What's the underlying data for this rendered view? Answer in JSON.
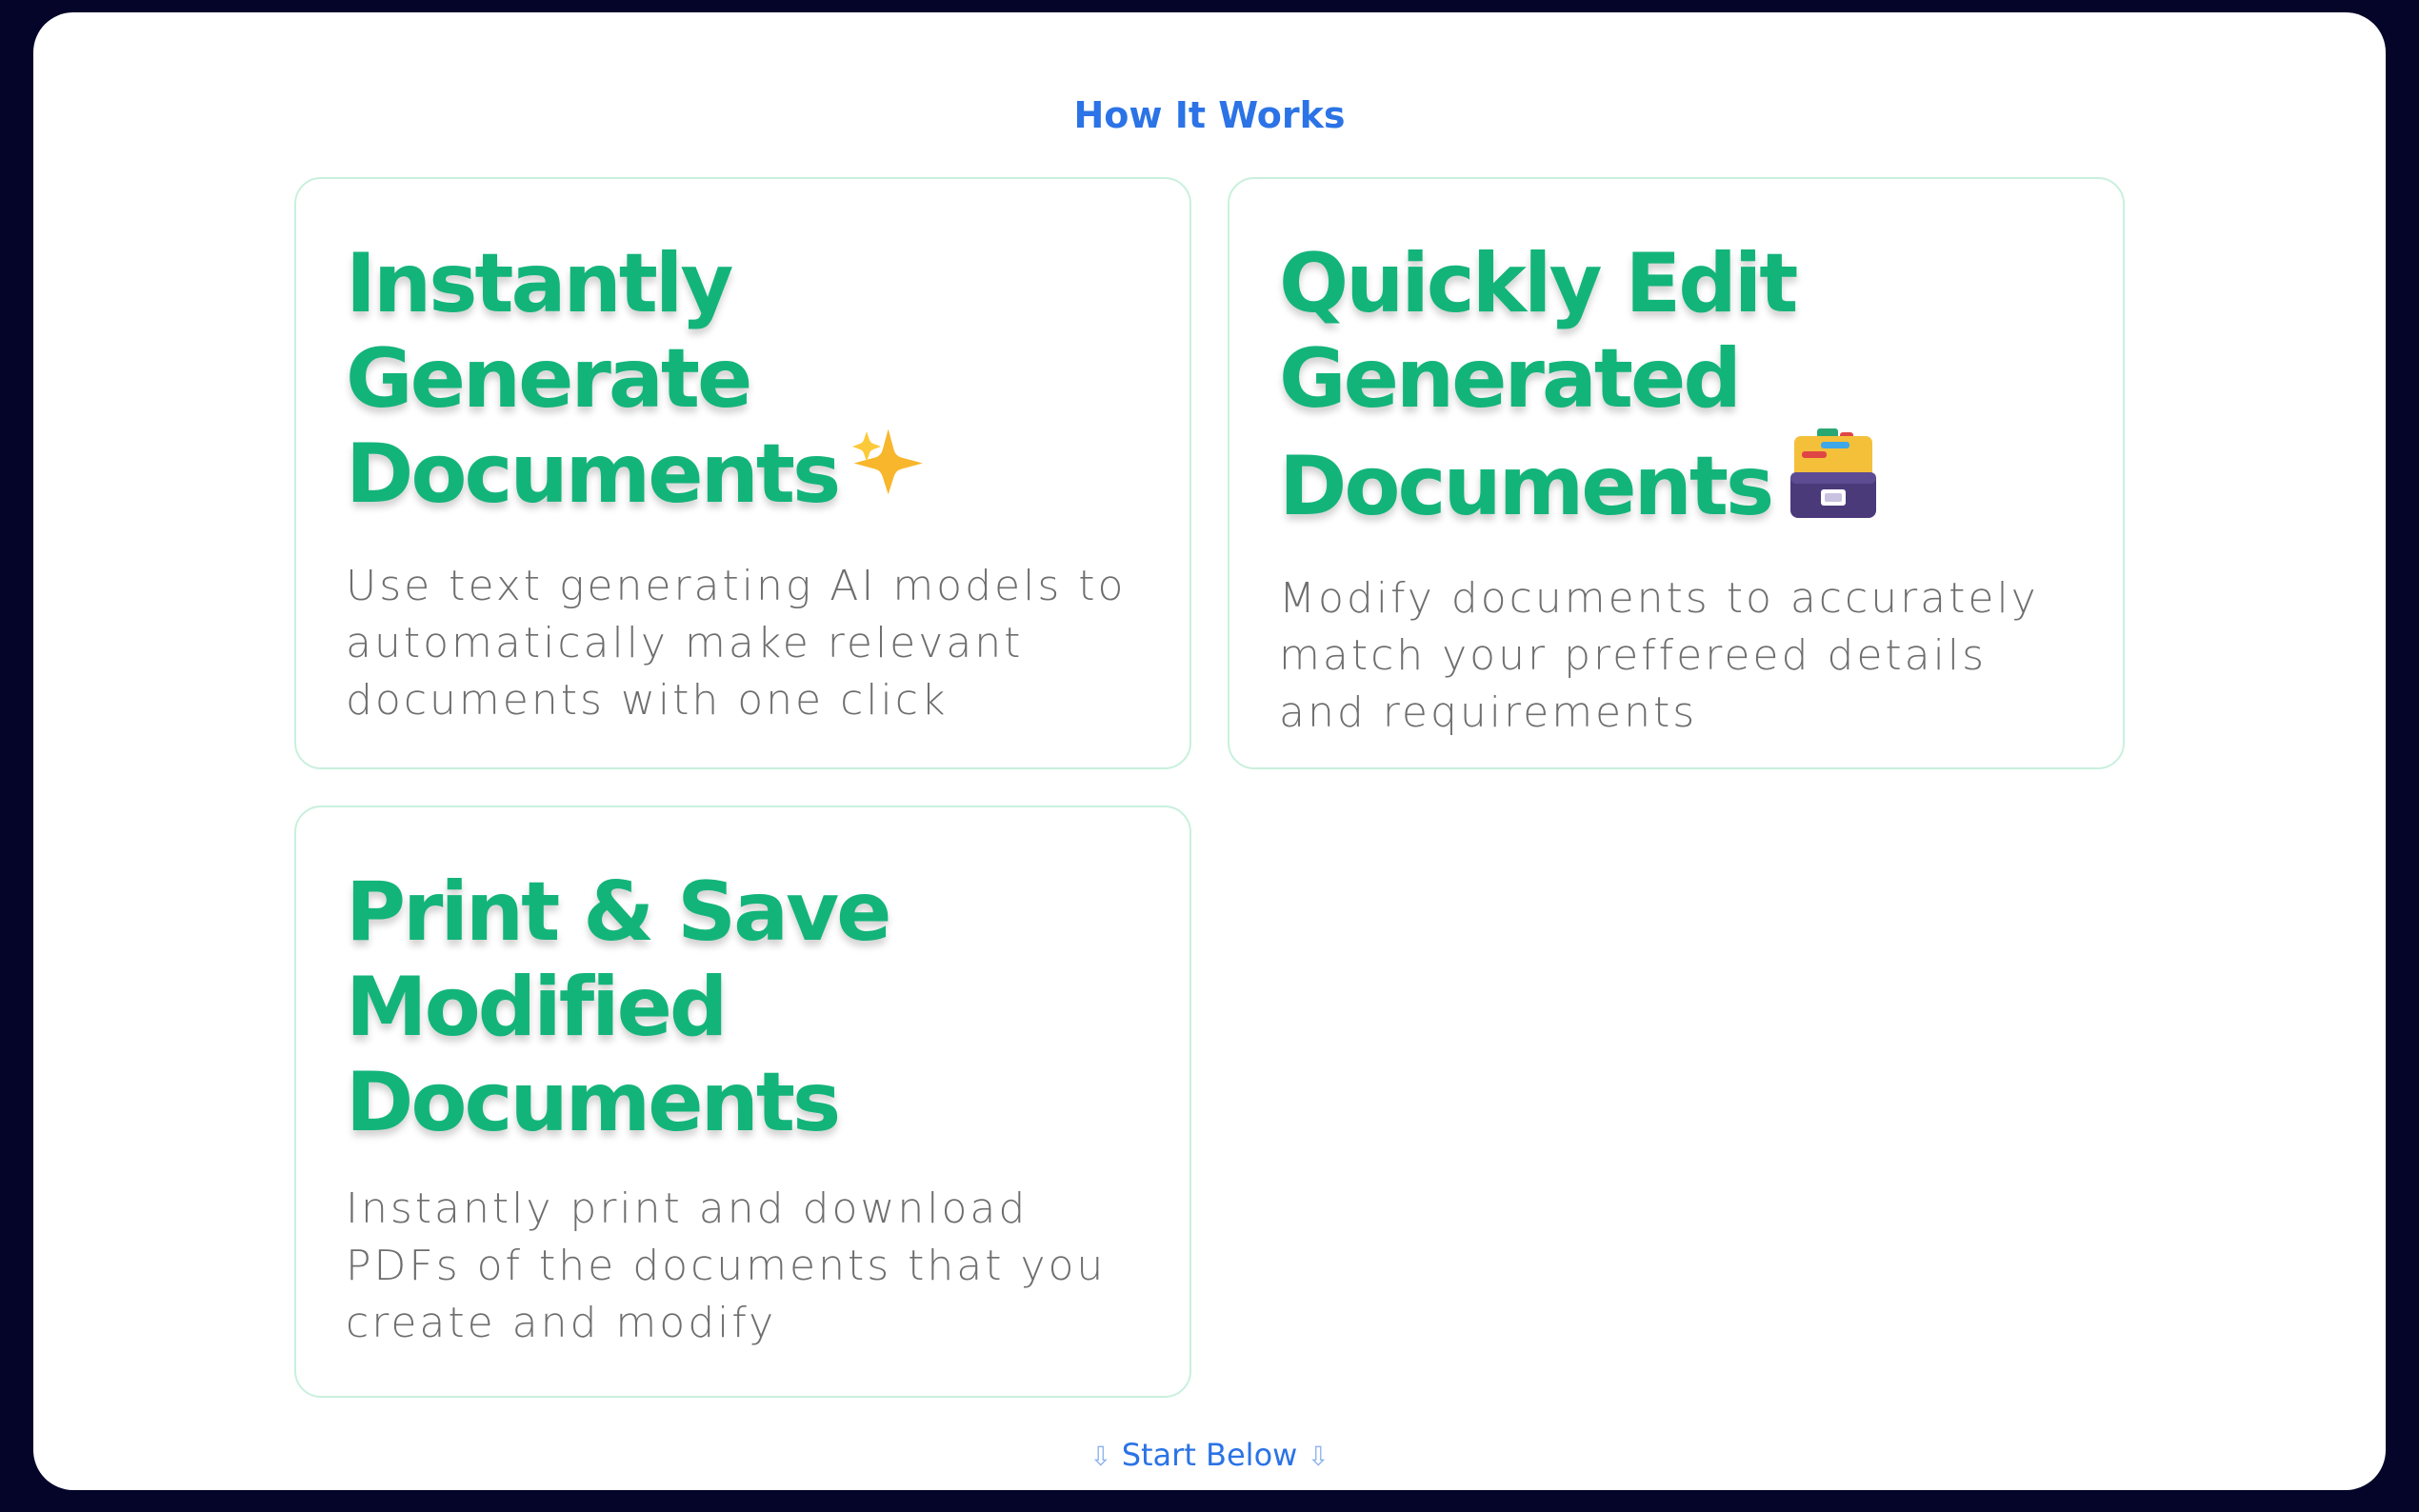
{
  "header": {
    "title": "How It Works"
  },
  "cards": [
    {
      "title_lines": [
        "Instantly",
        "Generate",
        "Documents"
      ],
      "icon": "sparkles-icon",
      "description": "Use text generating AI models to automatically make relevant documents with one click"
    },
    {
      "title_lines": [
        "Quickly Edit",
        "Generated",
        "Documents"
      ],
      "icon": "card-file-box-icon",
      "description": "Modify documents to accurately match your preffereed details and requirements"
    },
    {
      "title_lines": [
        "Print & Save",
        "Modified",
        "Documents"
      ],
      "icon": "",
      "description": "Instantly print and download PDFs of the documents that you create and modify"
    }
  ],
  "footer": {
    "cta_label": "Start Below",
    "arrow_glyph": "⇩"
  },
  "colors": {
    "background": "#05052a",
    "accent_blue": "#2b73e6",
    "accent_green": "#13b47a",
    "card_border": "#c9f0dd",
    "description_text": "#6e6e6e"
  }
}
